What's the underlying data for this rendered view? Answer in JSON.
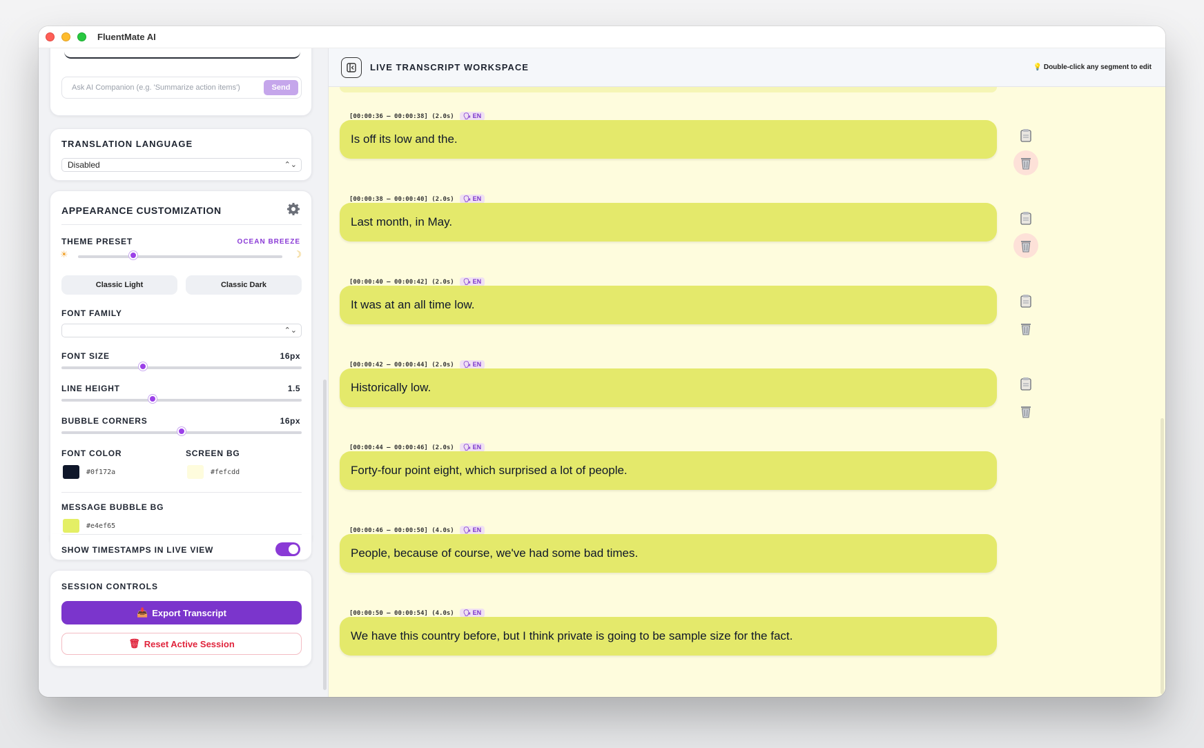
{
  "app": {
    "title": "FluentMate AI"
  },
  "ai": {
    "placeholder": "Ask AI Companion (e.g. 'Summarize action items')",
    "send_label": "Send"
  },
  "translation": {
    "heading": "TRANSLATION LANGUAGE",
    "selected": "Disabled"
  },
  "appearance": {
    "heading": "APPEARANCE CUSTOMIZATION",
    "theme_label": "THEME PRESET",
    "theme_value": "OCEAN BREEZE",
    "theme_level": 0.27,
    "preset_light": "Classic Light",
    "preset_dark": "Classic Dark",
    "font_family_label": "FONT FAMILY",
    "font_family_value": "",
    "font_size_label": "FONT SIZE",
    "font_size_value": "16px",
    "font_size_level": 0.34,
    "line_height_label": "LINE HEIGHT",
    "line_height_value": "1.5",
    "line_height_level": 0.38,
    "corners_label": "BUBBLE CORNERS",
    "corners_value": "16px",
    "corners_level": 0.5,
    "font_color_label": "FONT COLOR",
    "font_color": "#0f172a",
    "screen_bg_label": "SCREEN BG",
    "screen_bg": "#fefcdd",
    "bubble_bg_label": "MESSAGE BUBBLE BG",
    "bubble_bg": "#e4ef65",
    "timestamps_label": "SHOW TIMESTAMPS IN LIVE VIEW",
    "timestamps_on": true
  },
  "session": {
    "heading": "SESSION CONTROLS",
    "export_label": "Export Transcript",
    "reset_label": "Reset Active Session"
  },
  "workspace": {
    "title": "LIVE TRANSCRIPT WORKSPACE",
    "hint": "Double-click any segment to edit"
  },
  "segments": [
    {
      "time": "[00:00:36 – 00:00:38] (2.0s)",
      "lang": "EN",
      "text": "Is off its low and the."
    },
    {
      "time": "[00:00:38 – 00:00:40] (2.0s)",
      "lang": "EN",
      "text": "Last month, in May."
    },
    {
      "time": "[00:00:40 – 00:00:42] (2.0s)",
      "lang": "EN",
      "text": "It was at an all time low."
    },
    {
      "time": "[00:00:42 – 00:00:44] (2.0s)",
      "lang": "EN",
      "text": "Historically low."
    },
    {
      "time": "[00:00:44 – 00:00:46] (2.0s)",
      "lang": "EN",
      "text": "Forty-four point eight, which surprised a lot of people."
    },
    {
      "time": "[00:00:46 – 00:00:50] (4.0s)",
      "lang": "EN",
      "text": "People, because of course, we've had some bad times."
    },
    {
      "time": "[00:00:50 – 00:00:54] (4.0s)",
      "lang": "EN",
      "text": "We have this country before, but I think private is going to be sample size for the fact."
    }
  ],
  "icons": {
    "settings": "gear-icon",
    "sun": "sun-icon",
    "moon": "moon-icon",
    "copy": "clipboard-icon",
    "delete": "trash-icon",
    "export": "inbox-tray-icon",
    "collapse": "sidebar-collapse-icon",
    "hint": "lightbulb-icon",
    "lang": "speaker-icon"
  },
  "colors": {
    "accent": "#8a3ad6",
    "danger": "#e0243c"
  }
}
